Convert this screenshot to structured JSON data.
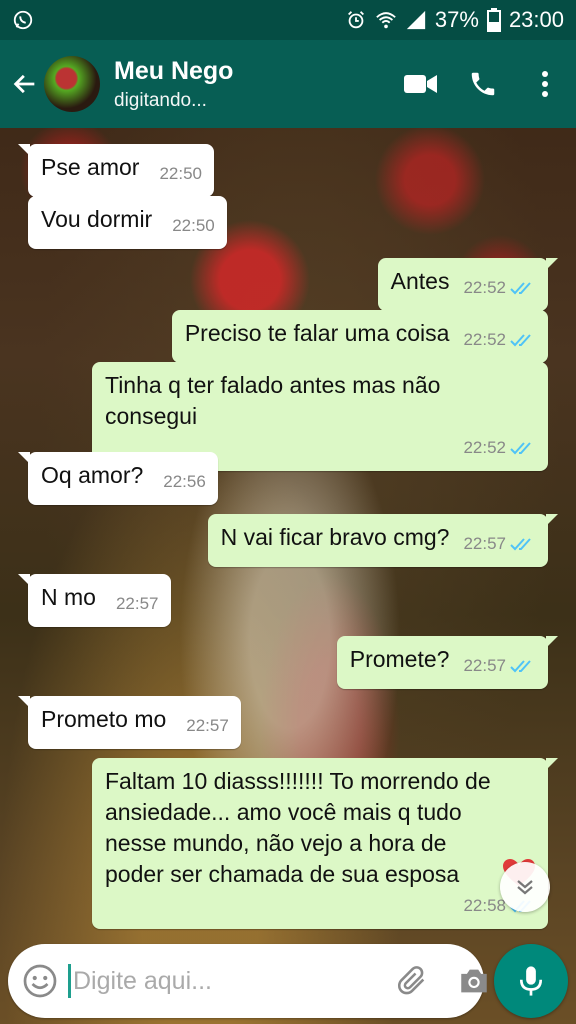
{
  "status_bar": {
    "battery": "37%",
    "time": "23:00"
  },
  "header": {
    "contact_name": "Meu Nego",
    "contact_status": "digitando..."
  },
  "messages": [
    {
      "dir": "in",
      "text": "Pse amor",
      "time": "22:50"
    },
    {
      "dir": "in",
      "text": "Vou dormir",
      "time": "22:50"
    },
    {
      "dir": "out",
      "text": "Antes",
      "time": "22:52",
      "read": true
    },
    {
      "dir": "out",
      "text": "Preciso te falar uma coisa",
      "time": "22:52",
      "read": true
    },
    {
      "dir": "out",
      "text": "Tinha q ter falado antes mas não consegui",
      "time": "22:52",
      "read": true
    },
    {
      "dir": "in",
      "text": "Oq amor?",
      "time": "22:56"
    },
    {
      "dir": "out",
      "text": "N vai ficar bravo cmg?",
      "time": "22:57",
      "read": true
    },
    {
      "dir": "in",
      "text": "N mo",
      "time": "22:57"
    },
    {
      "dir": "out",
      "text": "Promete?",
      "time": "22:57",
      "read": true
    },
    {
      "dir": "in",
      "text": "Prometo mo",
      "time": "22:57"
    },
    {
      "dir": "out",
      "text": "Faltam 10 diasss!!!!!!! To morrendo de ansiedade... amo você mais q tudo nesse mundo, não vejo a hora de poder ser chamada de sua esposa",
      "time": "22:58",
      "read": true
    }
  ],
  "input": {
    "placeholder": "Digite aqui..."
  },
  "icons": {
    "emoji": "emoji-icon",
    "attach": "paperclip-icon",
    "camera": "camera-icon",
    "mic": "microphone-icon",
    "video": "video-call-icon",
    "call": "phone-icon",
    "menu": "more-vertical-icon",
    "back": "arrow-back-icon",
    "scroll": "chevron-double-down-icon"
  },
  "colors": {
    "header": "#075e54",
    "status_bar": "#054d44",
    "outgoing_bubble": "#dcf8c6",
    "incoming_bubble": "#ffffff",
    "read_ticks": "#4fc3f7",
    "mic_button": "#00897b"
  }
}
